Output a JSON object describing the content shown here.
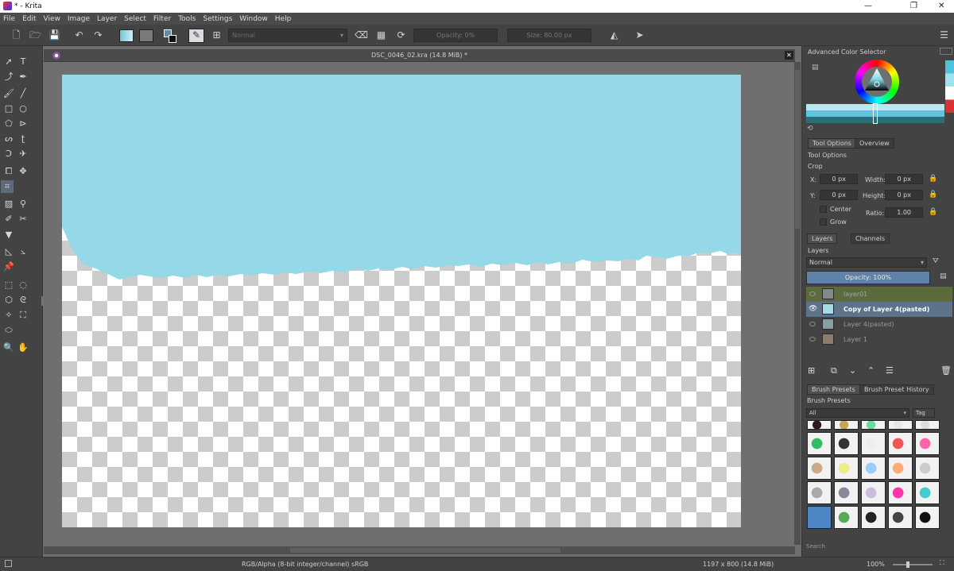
{
  "window": {
    "title": "* - Krita",
    "minimize": "—",
    "maximize": "❐",
    "close": "✕"
  },
  "menu": [
    "File",
    "Edit",
    "View",
    "Image",
    "Layer",
    "Select",
    "Filter",
    "Tools",
    "Settings",
    "Window",
    "Help"
  ],
  "toolbar": {
    "blend_mode": "Normal",
    "opacity": "Opacity: 0%",
    "size": "Size: 80.00 px"
  },
  "document": {
    "tab_title": "DSC_0046_02.kra (14.8 MiB) *",
    "close_icon": "✕"
  },
  "colors": {
    "sky": "#95d8e8",
    "checker_light": "#ffffff",
    "checker_dark": "#cccccc",
    "selected_tool": "#5d6a7a",
    "selected_layer": "#5c7389",
    "layer01_highlight": "#5c6a3c",
    "opacity_bar": "#5f82a6"
  },
  "color_selector": {
    "title": "Advanced Color Selector"
  },
  "tool_options": {
    "tabs": [
      "Tool Options",
      "Overview"
    ],
    "title": "Tool Options",
    "tool_name": "Crop",
    "x_label": "X:",
    "x_value": "0 px",
    "y_label": "Y:",
    "y_value": "0 px",
    "width_label": "Width:",
    "width_value": "0 px",
    "height_label": "Height:",
    "height_value": "0 px",
    "ratio_label": "Ratio:",
    "ratio_value": "1.00",
    "center_label": "Center",
    "grow_label": "Grow"
  },
  "layers": {
    "tabs": [
      "Layers",
      "Channels"
    ],
    "title": "Layers",
    "blend_mode": "Normal",
    "opacity": "Opacity: 100%",
    "items": [
      {
        "name": "layer01"
      },
      {
        "name": "Copy of Layer 4(pasted)"
      },
      {
        "name": "Layer 4(pasted)"
      },
      {
        "name": "Layer 1"
      }
    ]
  },
  "brush_presets": {
    "tabs": [
      "Brush Presets",
      "Brush Preset History"
    ],
    "title": "Brush Presets",
    "filter": "All",
    "tag_label": "Tag",
    "search_placeholder": "Search"
  },
  "status": {
    "color_space": "RGB/Alpha (8-bit integer/channel)  sRGB",
    "dimensions": "1197 x 800 (14.8 MiB)",
    "zoom": "100%"
  }
}
